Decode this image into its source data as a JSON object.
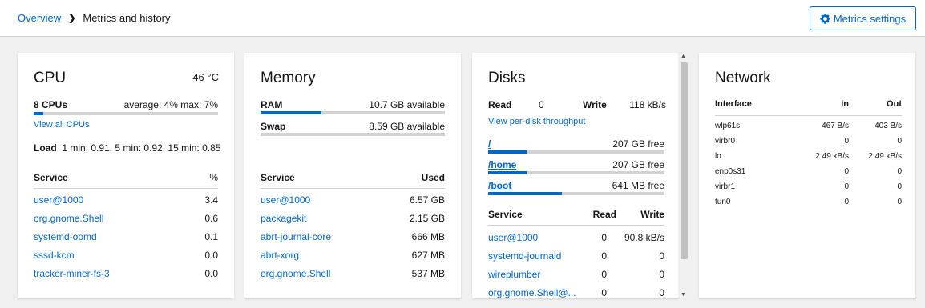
{
  "breadcrumb": {
    "home": "Overview",
    "current": "Metrics and history"
  },
  "toolbar": {
    "settings_label": "Metrics settings"
  },
  "cpu": {
    "title": "CPU",
    "temperature": "46 °C",
    "count_label": "8 CPUs",
    "average_label": "average: 4% max: 7%",
    "usage_fraction": 0.05,
    "view_all": "View all CPUs",
    "load_label": "Load",
    "load_values": "1 min: 0.91, 5 min: 0.92, 15 min: 0.85",
    "col_service": "Service",
    "col_percent": "%",
    "services": [
      {
        "name": "user@1000",
        "value": "3.4"
      },
      {
        "name": "org.gnome.Shell",
        "value": "0.6"
      },
      {
        "name": "systemd-oomd",
        "value": "0.1"
      },
      {
        "name": "sssd-kcm",
        "value": "0.0"
      },
      {
        "name": "tracker-miner-fs-3",
        "value": "0.0"
      }
    ]
  },
  "memory": {
    "title": "Memory",
    "ram_label": "RAM",
    "ram_value": "10.7 GB available",
    "ram_fraction": 0.33,
    "swap_label": "Swap",
    "swap_value": "8.59 GB available",
    "swap_fraction": 0.0,
    "col_service": "Service",
    "col_used": "Used",
    "services": [
      {
        "name": "user@1000",
        "value": "6.57 GB"
      },
      {
        "name": "packagekit",
        "value": "2.15 GB"
      },
      {
        "name": "abrt-journal-core",
        "value": "666 MB"
      },
      {
        "name": "abrt-xorg",
        "value": "627 MB"
      },
      {
        "name": "org.gnome.Shell",
        "value": "537 MB"
      }
    ]
  },
  "disks": {
    "title": "Disks",
    "read_label": "Read",
    "read_value": "0",
    "write_label": "Write",
    "write_value": "118 kB/s",
    "per_disk": "View per-disk throughput",
    "mounts": [
      {
        "name": "/",
        "free": "207 GB free",
        "fraction": 0.22
      },
      {
        "name": "/home",
        "free": "207 GB free",
        "fraction": 0.22
      },
      {
        "name": "/boot",
        "free": "641 MB free",
        "fraction": 0.42
      }
    ],
    "col_service": "Service",
    "col_read": "Read",
    "col_write": "Write",
    "services": [
      {
        "name": "user@1000",
        "read": "0",
        "write": "90.8 kB/s"
      },
      {
        "name": "systemd-journald",
        "read": "0",
        "write": "0"
      },
      {
        "name": "wireplumber",
        "read": "0",
        "write": "0"
      },
      {
        "name": "org.gnome.Shell@...",
        "read": "0",
        "write": "0"
      }
    ]
  },
  "network": {
    "title": "Network",
    "col_interface": "Interface",
    "col_in": "In",
    "col_out": "Out",
    "interfaces": [
      {
        "name": "wlp61s",
        "in": "467 B/s",
        "out": "403 B/s"
      },
      {
        "name": "virbr0",
        "in": "0",
        "out": "0"
      },
      {
        "name": "lo",
        "in": "2.49 kB/s",
        "out": "2.49 kB/s"
      },
      {
        "name": "enp0s31",
        "in": "0",
        "out": "0"
      },
      {
        "name": "virbr1",
        "in": "0",
        "out": "0"
      },
      {
        "name": "tun0",
        "in": "0",
        "out": "0"
      }
    ]
  },
  "colors": {
    "accent": "#0066cc",
    "track": "#d2d2d2",
    "background": "#f0f0f0"
  },
  "icons": {
    "settings": "gear-icon",
    "breadcrumb_separator": "chevron-right-icon"
  }
}
